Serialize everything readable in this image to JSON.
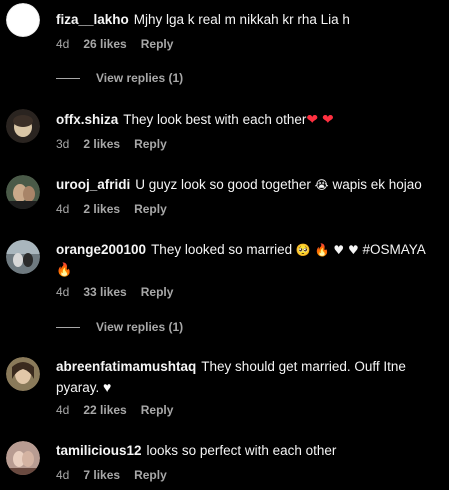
{
  "comments": [
    {
      "username": "fiza__lakho",
      "text": "Mjhy lga k real m nikkah kr rha Lia h",
      "age": "4d",
      "likes": "26 likes",
      "reply": "Reply"
    },
    {
      "username": "offx.shiza",
      "text": "They look best with each other",
      "emoji_suffix": "❤ ❤",
      "age": "3d",
      "likes": "2 likes",
      "reply": "Reply"
    },
    {
      "username": "urooj_afridi",
      "text": "U guyz look so good together",
      "emoji_mid": "😭",
      "text_after": "wapis ek hojao",
      "age": "4d",
      "likes": "2 likes",
      "reply": "Reply"
    },
    {
      "username": "orange200100",
      "text": "They looked so married",
      "emoji_suffix": "🥺 🔥 ♥ ♥",
      "hashtag": "#OSMAYA",
      "second_line_emoji": "🔥",
      "age": "4d",
      "likes": "33 likes",
      "reply": "Reply"
    },
    {
      "username": "abreenfatimamushtaq",
      "text": "They should get married. Ouff Itne",
      "second_line": "pyaray.",
      "emoji_suffix": "♥",
      "age": "4d",
      "likes": "22 likes",
      "reply": "Reply"
    },
    {
      "username": "tamilicious12",
      "text": "looks so perfect with each other",
      "age": "4d",
      "likes": "7 likes",
      "reply": "Reply"
    }
  ],
  "view_replies": [
    "View replies (1)",
    "View replies (1)"
  ],
  "colors": {
    "background": "#000000",
    "text": "#f5f5f5",
    "secondary": "#a8a8a8",
    "heart_red": "#ff3040"
  }
}
